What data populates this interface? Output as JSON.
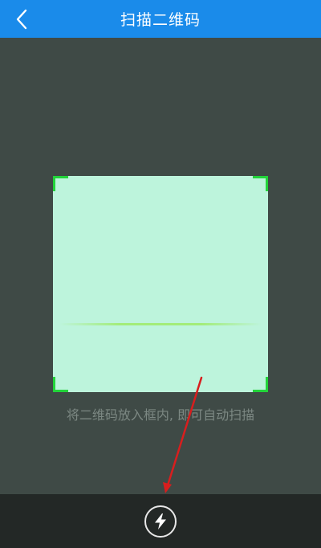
{
  "header": {
    "title": "扫描二维码",
    "back_icon": "chevron-left-icon"
  },
  "scanner": {
    "hint": "将二维码放入框内, 即可自动扫描"
  },
  "footer": {
    "flash_icon": "lightning-bolt-icon"
  },
  "colors": {
    "header_bg": "#1a8bea",
    "screen_bg": "#3f4a46",
    "scan_area_bg": "#bdf4dc",
    "corner": "#22d43a",
    "bottom_bar_bg": "#232826",
    "annotation_arrow": "#d81e1e"
  }
}
